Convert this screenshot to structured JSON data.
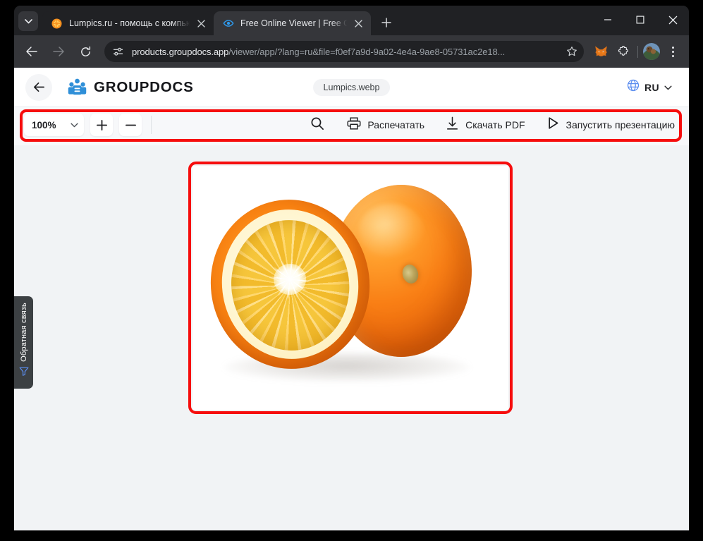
{
  "browser": {
    "tab_list_icon": "chevron-down-icon",
    "tabs": [
      {
        "title": "Lumpics.ru - помощь с компью",
        "favicon": "orange-fruit-favicon",
        "active": false
      },
      {
        "title": "Free Online Viewer | Free Group",
        "favicon": "eye-icon",
        "active": true
      }
    ],
    "new_tab_label": "+",
    "window_controls": {
      "minimize": "minimize-icon",
      "maximize": "maximize-icon",
      "close": "close-icon"
    },
    "nav": {
      "back": "back-arrow-icon",
      "forward": "forward-arrow-icon",
      "reload": "reload-icon"
    },
    "omnibox": {
      "site_info_icon": "tune-site-settings-icon",
      "url_host": "products.groupdocs.app",
      "url_path": "/viewer/app/?lang=ru&file=f0ef7a9d-9a02-4e4a-9ae8-05731ac2e18...",
      "bookmark_icon": "star-icon"
    },
    "toolbar_icons": [
      {
        "name": "metamask-extension-icon"
      },
      {
        "name": "extensions-puzzle-icon"
      }
    ],
    "profile_avatar": "avatar",
    "menu_icon": "three-dot-menu-icon"
  },
  "app": {
    "back_button": "back-arrow-icon",
    "brand": {
      "mark": "groupdocs-logo-icon",
      "name": "GROUPDOCS"
    },
    "file_name": "Lumpics.webp",
    "language": {
      "icon": "globe-icon",
      "code": "RU",
      "chevron": "chevron-down-icon"
    }
  },
  "toolbar": {
    "zoom_value": "100%",
    "zoom_chevron": "chevron-down-icon",
    "zoom_in": "plus-icon",
    "zoom_out": "minus-icon",
    "search": "search-icon",
    "buttons": [
      {
        "label": "Распечатать",
        "icon": "printer-icon"
      },
      {
        "label": "Скачать PDF",
        "icon": "download-icon"
      },
      {
        "label": "Запустить презентацию",
        "icon": "play-icon"
      }
    ]
  },
  "annotations": {
    "color": "#f60d0d",
    "toolbar_highlight": "toolbar-region",
    "image_highlight": "document-page-region"
  },
  "document": {
    "page_alt": "Фотография: разрезанный пополам апельсин и целый апельсин на белом фоне"
  },
  "feedback": {
    "label": "Обратная связь",
    "icon": "funnel-icon"
  }
}
